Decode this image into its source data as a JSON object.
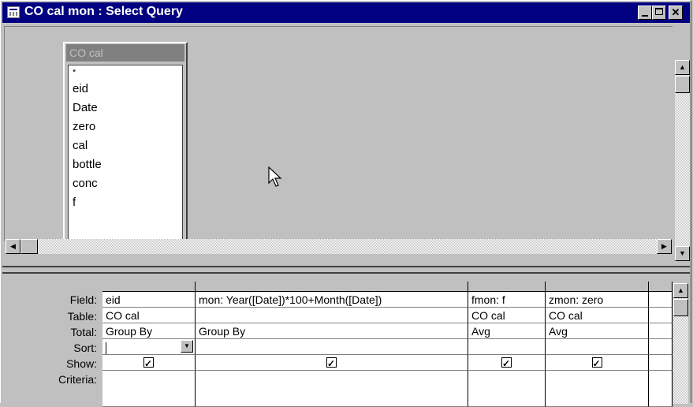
{
  "window": {
    "title": "CO cal mon : Select Query",
    "controls": [
      "minimize",
      "maximize",
      "close"
    ]
  },
  "field_list": {
    "table_name": "CO cal",
    "fields": [
      "*",
      "eid",
      "Date",
      "zero",
      "cal",
      "bottle",
      "conc",
      "f"
    ]
  },
  "grid": {
    "row_labels": {
      "field": "Field:",
      "table": "Table:",
      "total": "Total:",
      "sort": "Sort:",
      "show": "Show:",
      "criteria": "Criteria:"
    },
    "columns": [
      {
        "field": "eid",
        "table": "CO cal",
        "total": "Group By",
        "sort": "",
        "show": true,
        "criteria": ""
      },
      {
        "field": "mon: Year([Date])*100+Month([Date])",
        "table": "",
        "total": "Group By",
        "sort": "",
        "show": true,
        "criteria": ""
      },
      {
        "field": "fmon: f",
        "table": "CO cal",
        "total": "Avg",
        "sort": "",
        "show": true,
        "criteria": ""
      },
      {
        "field": "zmon: zero",
        "table": "CO cal",
        "total": "Avg",
        "sort": "",
        "show": true,
        "criteria": ""
      }
    ]
  },
  "icons": {
    "title": "query-icon",
    "cursor": "mouse-pointer-icon"
  }
}
